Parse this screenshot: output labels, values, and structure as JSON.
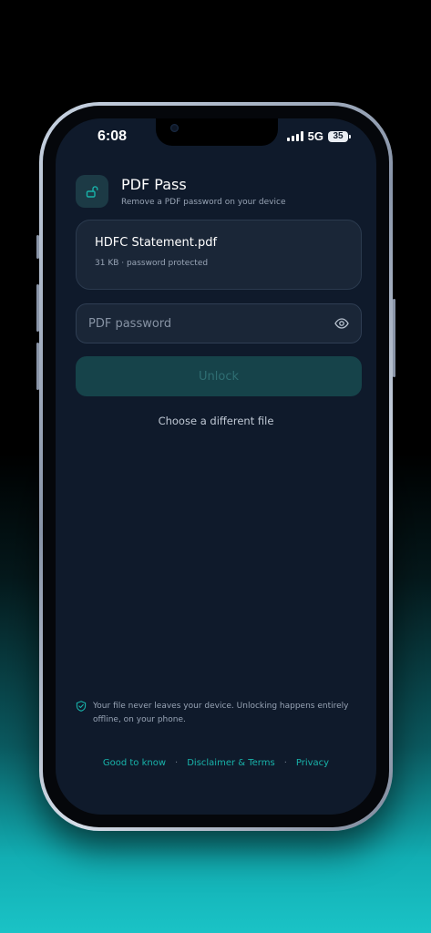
{
  "status_bar": {
    "time": "6:08",
    "network": "5G",
    "battery": "35"
  },
  "app": {
    "title": "PDF Pass",
    "subtitle": "Remove a PDF password on your device",
    "logo_icon": "unlock-icon",
    "accent_color": "#18b3aa"
  },
  "file": {
    "name": "HDFC Statement.pdf",
    "meta": "31 KB · password protected"
  },
  "password": {
    "value": "",
    "placeholder": "PDF password",
    "toggle_icon": "eye-icon"
  },
  "unlock_button": {
    "label": "Unlock",
    "enabled": false
  },
  "change_file_link": "Choose a different file",
  "privacy": {
    "icon": "shield-check-icon",
    "text": "Your file never leaves your device. Unlocking happens entirely offline, on your phone."
  },
  "footer": {
    "links": [
      "Good to know",
      "Disclaimer & Terms",
      "Privacy"
    ],
    "separator": "·"
  }
}
